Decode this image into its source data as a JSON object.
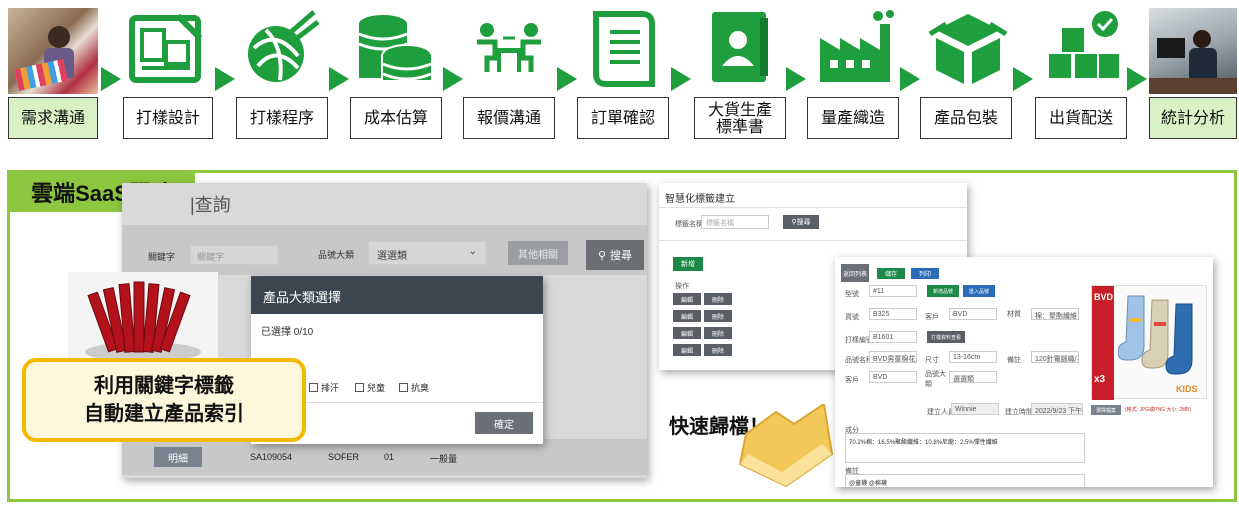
{
  "process_steps": [
    {
      "label": "需求溝通",
      "icon": "meeting-photo"
    },
    {
      "label": "打樣設計",
      "icon": "blueprint-icon"
    },
    {
      "label": "打樣程序",
      "icon": "yarn-ball-icon"
    },
    {
      "label": "成本估算",
      "icon": "coin-stack-icon"
    },
    {
      "label": "報價溝通",
      "icon": "negotiation-icon"
    },
    {
      "label": "訂單確認",
      "icon": "scroll-document-icon"
    },
    {
      "label": "大貨生產\n標準書",
      "icon": "id-book-icon"
    },
    {
      "label": "量產織造",
      "icon": "factory-icon"
    },
    {
      "label": "產品包裝",
      "icon": "package-box-icon"
    },
    {
      "label": "出貨配送",
      "icon": "boxes-check-icon"
    },
    {
      "label": "統計分析",
      "icon": "office-photo"
    }
  ],
  "saas": {
    "title": "雲端SaaS服務",
    "callout_line1": "利用關鍵字標籤",
    "callout_line2": "自動建立產品索引",
    "quick_archive": "快速歸檔！"
  },
  "query_screen": {
    "title_partial": "|查詢",
    "keyword_label": "關鍵字",
    "keyword_placeholder": "關鍵字",
    "category_label": "品號大類",
    "category_value": "選選類",
    "other_button": "其他相關",
    "search_button": "搜尋",
    "row_button": "明細",
    "row_values": [
      "SA109054",
      "SOFER",
      "01",
      "一般量"
    ],
    "side_text": "相）"
  },
  "category_modal": {
    "title": "產品大類選擇",
    "selected_count": "已選擇 0/10",
    "options": [
      "排汗",
      "兒童",
      "抗臭"
    ],
    "confirm_button": "確定"
  },
  "tag_screen": {
    "title": "智慧化標籤建立",
    "field_label": "標籤名稱",
    "field_placeholder": "標籤名稱",
    "search_button": "搜尋",
    "add_button": "新增",
    "column_label": "操作",
    "edit_label": "編輯",
    "delete_label": "刪除"
  },
  "product_screen": {
    "back_button": "返回列表",
    "save_button": "儲存",
    "print_button": "列印",
    "rows": [
      {
        "label": "型號",
        "value": "#11",
        "extra1": "新增品號",
        "extra2": "匯入品號"
      },
      {
        "label": "貨號",
        "value": "B325",
        "label2": "客戶",
        "value2": "BVD",
        "label3": "材質",
        "value3": "棉：聚酯纖維：彈"
      },
      {
        "label": "打樣編號",
        "value": "B1601",
        "action": "打樣資料查看"
      },
      {
        "label": "品號名稱",
        "value": "BVD男童棉花1/2(",
        "label2": "尺寸",
        "value2": "13-16cm",
        "label3": "備註",
        "value3": "120針電腦織/平車"
      },
      {
        "label": "客戶",
        "value": "BVD",
        "label2": "品號大類",
        "value2": "選選類"
      }
    ],
    "creator_label": "建立人員",
    "creator_value": "Winnie",
    "date_label": "建立時間",
    "date_value": "2022/9/23 下午 C",
    "image_button": "選擇檔案",
    "image_note": "(格式: JPG或PNG 大小: 2MB)",
    "composition_label": "成分",
    "composition_value": "70.2%棉：16.5%聚酯纖維：10.8%尼龍：2.5%彈性纖維",
    "notes_label": "備註",
    "notes_value": "@童襪 @棉襪",
    "brand_logo": "BVD",
    "pack_count": "x3",
    "kids_logo": "KIDS"
  },
  "colors": {
    "step_green": "#1e9e3c",
    "panel_green": "#8dc63f",
    "highlight_label": "#d9f2c5",
    "callout_border": "#f5b800"
  }
}
